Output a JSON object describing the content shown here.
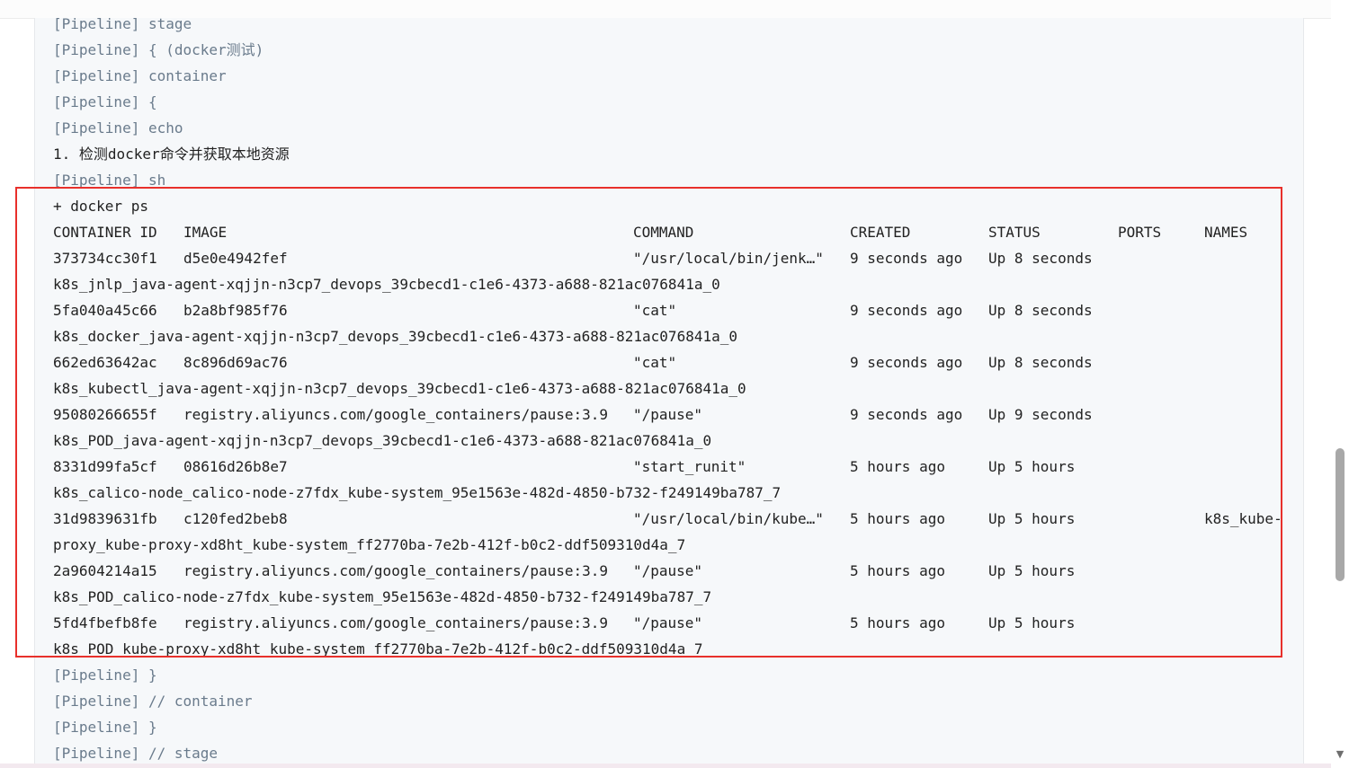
{
  "console": {
    "pre_lines": [
      "[Pipeline] stage",
      "[Pipeline] { (docker测试)",
      "[Pipeline] container",
      "[Pipeline] {",
      "[Pipeline] echo",
      "1. 检测docker命令并获取本地资源",
      "[Pipeline] sh"
    ],
    "command": "+ docker ps",
    "table": {
      "headers": [
        "CONTAINER ID",
        "IMAGE",
        "COMMAND",
        "CREATED",
        "STATUS",
        "PORTS",
        "NAMES"
      ],
      "rows": [
        {
          "id": "373734cc30f1",
          "image": "d5e0e4942fef",
          "command": "\"/usr/local/bin/jenk…\"",
          "created": "9 seconds ago",
          "status": "Up 8 seconds",
          "ports": "",
          "names": "",
          "name_wrap": "k8s_jnlp_java-agent-xqjjn-n3cp7_devops_39cbecd1-c1e6-4373-a688-821ac076841a_0"
        },
        {
          "id": "5fa040a45c66",
          "image": "b2a8bf985f76",
          "command": "\"cat\"",
          "created": "9 seconds ago",
          "status": "Up 8 seconds",
          "ports": "",
          "names": "",
          "name_wrap": "k8s_docker_java-agent-xqjjn-n3cp7_devops_39cbecd1-c1e6-4373-a688-821ac076841a_0"
        },
        {
          "id": "662ed63642ac",
          "image": "8c896d69ac76",
          "command": "\"cat\"",
          "created": "9 seconds ago",
          "status": "Up 8 seconds",
          "ports": "",
          "names": "",
          "name_wrap": "k8s_kubectl_java-agent-xqjjn-n3cp7_devops_39cbecd1-c1e6-4373-a688-821ac076841a_0"
        },
        {
          "id": "95080266655f",
          "image": "registry.aliyuncs.com/google_containers/pause:3.9",
          "command": "\"/pause\"",
          "created": "9 seconds ago",
          "status": "Up 9 seconds",
          "ports": "",
          "names": "",
          "name_wrap": "k8s_POD_java-agent-xqjjn-n3cp7_devops_39cbecd1-c1e6-4373-a688-821ac076841a_0"
        },
        {
          "id": "8331d99fa5cf",
          "image": "08616d26b8e7",
          "command": "\"start_runit\"",
          "created": "5 hours ago",
          "status": "Up 5 hours",
          "ports": "",
          "names": "",
          "name_wrap": "k8s_calico-node_calico-node-z7fdx_kube-system_95e1563e-482d-4850-b732-f249149ba787_7"
        },
        {
          "id": "31d9839631fb",
          "image": "c120fed2beb8",
          "command": "\"/usr/local/bin/kube…\"",
          "created": "5 hours ago",
          "status": "Up 5 hours",
          "ports": "",
          "names": "k8s_kube-",
          "name_wrap": "proxy_kube-proxy-xd8ht_kube-system_ff2770ba-7e2b-412f-b0c2-ddf509310d4a_7"
        },
        {
          "id": "2a9604214a15",
          "image": "registry.aliyuncs.com/google_containers/pause:3.9",
          "command": "\"/pause\"",
          "created": "5 hours ago",
          "status": "Up 5 hours",
          "ports": "",
          "names": "",
          "name_wrap": "k8s_POD_calico-node-z7fdx_kube-system_95e1563e-482d-4850-b732-f249149ba787_7"
        },
        {
          "id": "5fd4fbefb8fe",
          "image": "registry.aliyuncs.com/google_containers/pause:3.9",
          "command": "\"/pause\"",
          "created": "5 hours ago",
          "status": "Up 5 hours",
          "ports": "",
          "names": "",
          "name_wrap": "k8s_POD_kube-proxy-xd8ht_kube-system_ff2770ba-7e2b-412f-b0c2-ddf509310d4a_7"
        }
      ]
    },
    "post_lines": [
      "[Pipeline] }",
      "[Pipeline] // container",
      "[Pipeline] }",
      "[Pipeline] // stage"
    ]
  },
  "colors": {
    "pipeline_text": "#6a7b8c",
    "output_text": "#222222",
    "highlight": "#e8302b",
    "console_bg": "#f6f8fa"
  }
}
